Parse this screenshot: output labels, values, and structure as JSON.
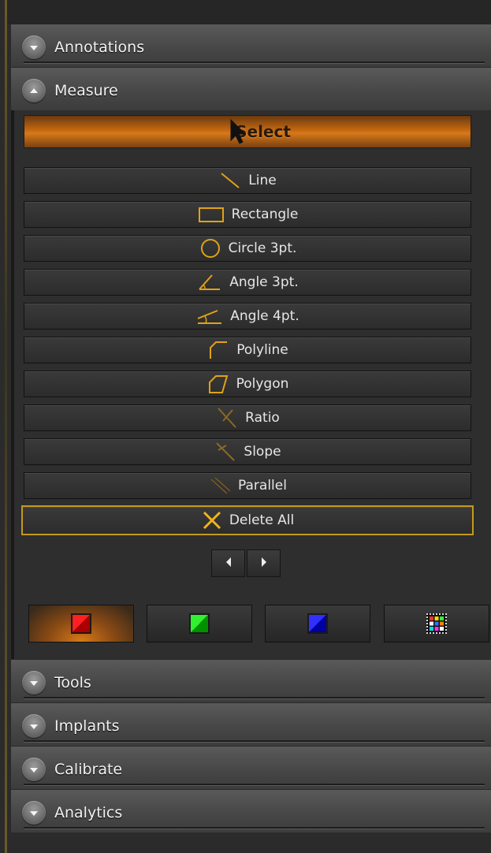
{
  "colors": {
    "accent": "#d7791a",
    "danger_border": "#c49a1a",
    "icon_gold": "#e0a218",
    "text": "#e6e6e6"
  },
  "sections": {
    "annotations": {
      "label": "Annotations",
      "icon": "chevron-down-icon"
    },
    "measure": {
      "label": "Measure",
      "icon": "chevron-up-icon"
    },
    "tools": {
      "label": "Tools",
      "icon": "chevron-down-icon"
    },
    "implants": {
      "label": "Implants",
      "icon": "chevron-down-icon"
    },
    "calibrate": {
      "label": "Calibrate",
      "icon": "chevron-down-icon"
    },
    "analytics": {
      "label": "Analytics",
      "icon": "chevron-down-icon"
    }
  },
  "measure": {
    "select_label": "Select",
    "tools": [
      {
        "label": "Line",
        "icon": "line-icon"
      },
      {
        "label": "Rectangle",
        "icon": "rectangle-icon"
      },
      {
        "label": "Circle 3pt.",
        "icon": "circle-icon"
      },
      {
        "label": "Angle 3pt.",
        "icon": "angle-3pt-icon"
      },
      {
        "label": "Angle 4pt.",
        "icon": "angle-4pt-icon"
      },
      {
        "label": "Polyline",
        "icon": "polyline-icon"
      },
      {
        "label": "Polygon",
        "icon": "polygon-icon"
      },
      {
        "label": "Ratio",
        "icon": "ratio-icon"
      },
      {
        "label": "Slope",
        "icon": "slope-icon"
      },
      {
        "label": "Parallel",
        "icon": "parallel-icon"
      }
    ],
    "delete_all_label": "Delete All",
    "colors": [
      {
        "name": "red",
        "hex": "#ff0000",
        "active": true
      },
      {
        "name": "green",
        "hex": "#00d000",
        "active": false
      },
      {
        "name": "blue",
        "hex": "#1010ff",
        "active": false
      },
      {
        "name": "custom",
        "hex": "#ffffff",
        "active": false
      }
    ]
  }
}
